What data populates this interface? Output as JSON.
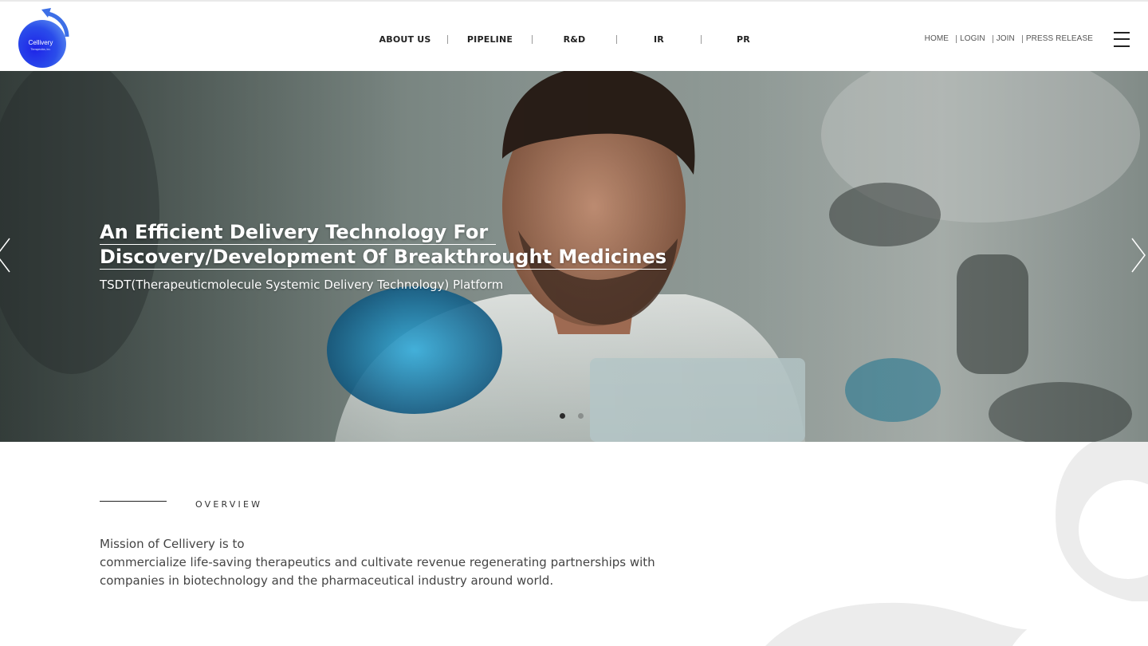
{
  "brand": {
    "logo_text": "Cellivery",
    "logo_subtext": "Therapeutics, Inc.",
    "logo_colors": {
      "circle_inner": "#1e24e8",
      "circle_outer": "#5a8cf0",
      "arrow": "#3d6fe6"
    }
  },
  "main_nav": {
    "items": [
      {
        "label": "ABOUT US"
      },
      {
        "label": "PIPELINE"
      },
      {
        "label": "R&D"
      },
      {
        "label": "IR"
      },
      {
        "label": "PR"
      }
    ]
  },
  "util_nav": {
    "items": [
      {
        "label": "HOME"
      },
      {
        "label": "LOGIN"
      },
      {
        "label": "JOIN"
      },
      {
        "label": "PRESS RELEASE"
      }
    ]
  },
  "menu_icon": "hamburger-icon",
  "hero": {
    "title_line1": "An Efficient Delivery Technology For",
    "title_line2": "Discovery/Development Of Breakthrought Medicines",
    "subtitle": "TSDT(Therapeuticmolecule Systemic Delivery Technology) Platform",
    "prev_icon": "chevron-left-icon",
    "next_icon": "chevron-right-icon",
    "slides_total": 2,
    "active_slide": 1,
    "dot_colors": {
      "active": "#2b2b2b",
      "inactive": "#8a8f8d"
    }
  },
  "overview": {
    "label": "OVERVIEW",
    "text_line1": "Mission of Cellivery is to",
    "text_line2": "commercialize life-saving therapeutics and cultivate revenue regenerating partnerships with",
    "text_line3": "companies in biotechnology and the pharmaceutical industry around world."
  }
}
